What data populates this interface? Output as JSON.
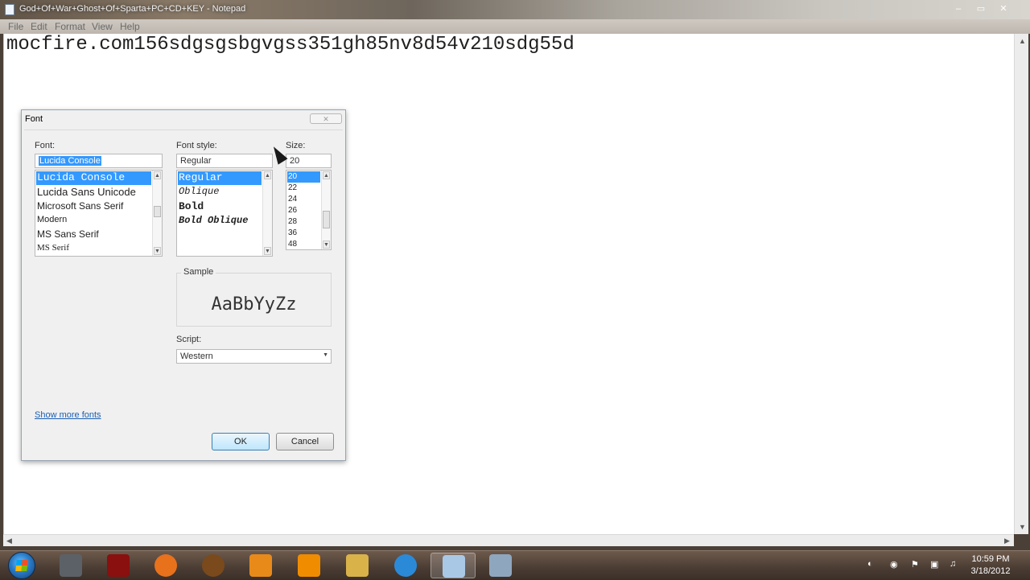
{
  "window": {
    "title": "God+Of+War+Ghost+Of+Sparta+PC+CD+KEY - Notepad",
    "controls": [
      "–",
      "▭",
      "✕"
    ]
  },
  "menu": [
    "File",
    "Edit",
    "Format",
    "View",
    "Help"
  ],
  "editor": {
    "content": "mocfire.com156sdgsgsbgvgss351gh85nv8d54v210sdg55d"
  },
  "font_dialog": {
    "title": "Font",
    "font_label": "Font:",
    "font_value": "Lucida Console",
    "fonts": [
      "Lucida Console",
      "Lucida Sans Unicode",
      "Microsoft Sans Serif",
      "Modern",
      "MS Sans Serif",
      "MS Serif"
    ],
    "selected_font": "Lucida Console",
    "style_label": "Font style:",
    "style_value": "Regular",
    "styles": [
      "Regular",
      "Oblique",
      "Bold",
      "Bold Oblique"
    ],
    "size_label": "Size:",
    "size_value": "20",
    "sizes": [
      "20",
      "22",
      "24",
      "26",
      "28",
      "36",
      "48"
    ],
    "sample_label": "Sample",
    "sample_text": "AaBbYyZz",
    "script_label": "Script:",
    "script_value": "Western",
    "show_more_fonts": "Show more fonts",
    "ok_label": "OK",
    "cancel_label": "Cancel"
  },
  "taskbar": {
    "pinned": [
      {
        "name": "counter-strike-icon",
        "color": "#5c6168"
      },
      {
        "name": "red-emblem-icon",
        "color": "#8a0f0f"
      },
      {
        "name": "firefox-icon",
        "color": "#e8711c"
      },
      {
        "name": "orb-icon",
        "color": "#7a4a1c"
      },
      {
        "name": "media-player-icon",
        "color": "#e88a1a"
      },
      {
        "name": "vlc-icon",
        "color": "#f08c00"
      },
      {
        "name": "explorer-folder-icon",
        "color": "#d9b24a"
      },
      {
        "name": "internet-explorer-icon",
        "color": "#2a8ad8"
      },
      {
        "name": "notepad-icon",
        "color": "#a9c8e6"
      },
      {
        "name": "calculator-icon",
        "color": "#8fa6bf"
      }
    ],
    "clock_time": "10:59 PM",
    "clock_date": "3/18/2012"
  }
}
